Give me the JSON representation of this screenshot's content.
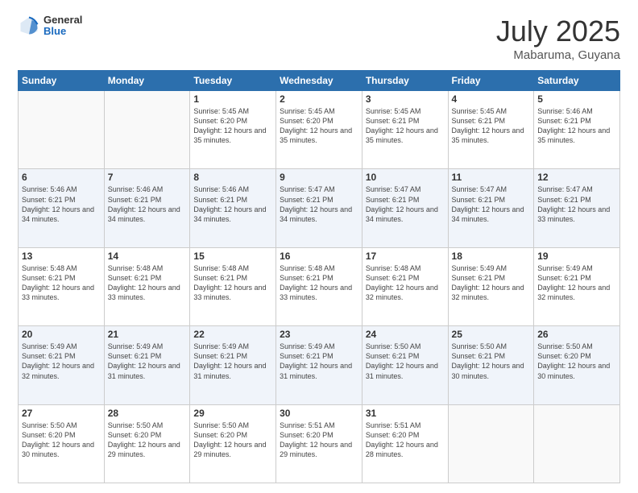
{
  "header": {
    "logo_general": "General",
    "logo_blue": "Blue",
    "month_year": "July 2025",
    "location": "Mabaruma, Guyana"
  },
  "days_of_week": [
    "Sunday",
    "Monday",
    "Tuesday",
    "Wednesday",
    "Thursday",
    "Friday",
    "Saturday"
  ],
  "weeks": [
    [
      {
        "day": "",
        "info": ""
      },
      {
        "day": "",
        "info": ""
      },
      {
        "day": "1",
        "info": "Sunrise: 5:45 AM\nSunset: 6:20 PM\nDaylight: 12 hours and 35 minutes."
      },
      {
        "day": "2",
        "info": "Sunrise: 5:45 AM\nSunset: 6:20 PM\nDaylight: 12 hours and 35 minutes."
      },
      {
        "day": "3",
        "info": "Sunrise: 5:45 AM\nSunset: 6:21 PM\nDaylight: 12 hours and 35 minutes."
      },
      {
        "day": "4",
        "info": "Sunrise: 5:45 AM\nSunset: 6:21 PM\nDaylight: 12 hours and 35 minutes."
      },
      {
        "day": "5",
        "info": "Sunrise: 5:46 AM\nSunset: 6:21 PM\nDaylight: 12 hours and 35 minutes."
      }
    ],
    [
      {
        "day": "6",
        "info": "Sunrise: 5:46 AM\nSunset: 6:21 PM\nDaylight: 12 hours and 34 minutes."
      },
      {
        "day": "7",
        "info": "Sunrise: 5:46 AM\nSunset: 6:21 PM\nDaylight: 12 hours and 34 minutes."
      },
      {
        "day": "8",
        "info": "Sunrise: 5:46 AM\nSunset: 6:21 PM\nDaylight: 12 hours and 34 minutes."
      },
      {
        "day": "9",
        "info": "Sunrise: 5:47 AM\nSunset: 6:21 PM\nDaylight: 12 hours and 34 minutes."
      },
      {
        "day": "10",
        "info": "Sunrise: 5:47 AM\nSunset: 6:21 PM\nDaylight: 12 hours and 34 minutes."
      },
      {
        "day": "11",
        "info": "Sunrise: 5:47 AM\nSunset: 6:21 PM\nDaylight: 12 hours and 34 minutes."
      },
      {
        "day": "12",
        "info": "Sunrise: 5:47 AM\nSunset: 6:21 PM\nDaylight: 12 hours and 33 minutes."
      }
    ],
    [
      {
        "day": "13",
        "info": "Sunrise: 5:48 AM\nSunset: 6:21 PM\nDaylight: 12 hours and 33 minutes."
      },
      {
        "day": "14",
        "info": "Sunrise: 5:48 AM\nSunset: 6:21 PM\nDaylight: 12 hours and 33 minutes."
      },
      {
        "day": "15",
        "info": "Sunrise: 5:48 AM\nSunset: 6:21 PM\nDaylight: 12 hours and 33 minutes."
      },
      {
        "day": "16",
        "info": "Sunrise: 5:48 AM\nSunset: 6:21 PM\nDaylight: 12 hours and 33 minutes."
      },
      {
        "day": "17",
        "info": "Sunrise: 5:48 AM\nSunset: 6:21 PM\nDaylight: 12 hours and 32 minutes."
      },
      {
        "day": "18",
        "info": "Sunrise: 5:49 AM\nSunset: 6:21 PM\nDaylight: 12 hours and 32 minutes."
      },
      {
        "day": "19",
        "info": "Sunrise: 5:49 AM\nSunset: 6:21 PM\nDaylight: 12 hours and 32 minutes."
      }
    ],
    [
      {
        "day": "20",
        "info": "Sunrise: 5:49 AM\nSunset: 6:21 PM\nDaylight: 12 hours and 32 minutes."
      },
      {
        "day": "21",
        "info": "Sunrise: 5:49 AM\nSunset: 6:21 PM\nDaylight: 12 hours and 31 minutes."
      },
      {
        "day": "22",
        "info": "Sunrise: 5:49 AM\nSunset: 6:21 PM\nDaylight: 12 hours and 31 minutes."
      },
      {
        "day": "23",
        "info": "Sunrise: 5:49 AM\nSunset: 6:21 PM\nDaylight: 12 hours and 31 minutes."
      },
      {
        "day": "24",
        "info": "Sunrise: 5:50 AM\nSunset: 6:21 PM\nDaylight: 12 hours and 31 minutes."
      },
      {
        "day": "25",
        "info": "Sunrise: 5:50 AM\nSunset: 6:21 PM\nDaylight: 12 hours and 30 minutes."
      },
      {
        "day": "26",
        "info": "Sunrise: 5:50 AM\nSunset: 6:20 PM\nDaylight: 12 hours and 30 minutes."
      }
    ],
    [
      {
        "day": "27",
        "info": "Sunrise: 5:50 AM\nSunset: 6:20 PM\nDaylight: 12 hours and 30 minutes."
      },
      {
        "day": "28",
        "info": "Sunrise: 5:50 AM\nSunset: 6:20 PM\nDaylight: 12 hours and 29 minutes."
      },
      {
        "day": "29",
        "info": "Sunrise: 5:50 AM\nSunset: 6:20 PM\nDaylight: 12 hours and 29 minutes."
      },
      {
        "day": "30",
        "info": "Sunrise: 5:51 AM\nSunset: 6:20 PM\nDaylight: 12 hours and 29 minutes."
      },
      {
        "day": "31",
        "info": "Sunrise: 5:51 AM\nSunset: 6:20 PM\nDaylight: 12 hours and 28 minutes."
      },
      {
        "day": "",
        "info": ""
      },
      {
        "day": "",
        "info": ""
      }
    ]
  ]
}
